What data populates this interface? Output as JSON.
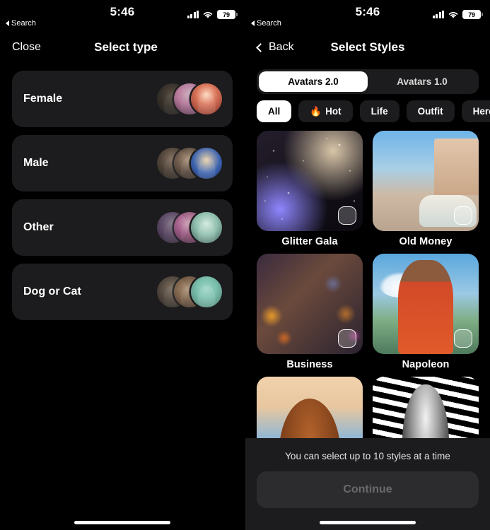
{
  "status_bar": {
    "time": "5:46",
    "back_label": "Search",
    "battery_percent": "79",
    "signal_icon": "cellular-bars-icon",
    "wifi_icon": "wifi-icon",
    "battery_icon": "battery-icon"
  },
  "left_screen": {
    "nav": {
      "close_label": "Close",
      "title": "Select type"
    },
    "types": [
      {
        "label": "Female",
        "avatars": [
          "a-dark",
          "a-pink",
          "a-red"
        ]
      },
      {
        "label": "Male",
        "avatars": [
          "a-man3",
          "a-man2",
          "a-pharaoh"
        ]
      },
      {
        "label": "Other",
        "avatars": [
          "a-purple",
          "a-punk",
          "a-mint"
        ]
      },
      {
        "label": "Dog or Cat",
        "avatars": [
          "a-dog3",
          "a-dog2",
          "a-shiba"
        ]
      }
    ]
  },
  "right_screen": {
    "nav": {
      "back_label": "Back",
      "title": "Select Styles",
      "back_icon": "chevron-left-icon"
    },
    "segments": [
      {
        "label": "Avatars 2.0",
        "selected": true
      },
      {
        "label": "Avatars 1.0",
        "selected": false
      }
    ],
    "filters": [
      {
        "label": "All",
        "icon": "",
        "selected": true
      },
      {
        "label": "Hot",
        "icon": "🔥",
        "selected": false
      },
      {
        "label": "Life",
        "icon": "",
        "selected": false
      },
      {
        "label": "Outfit",
        "icon": "",
        "selected": false
      },
      {
        "label": "Heroes",
        "icon": "",
        "selected": false
      }
    ],
    "styles": [
      {
        "label": "Glitter Gala",
        "art": "art-glitter",
        "checked": false
      },
      {
        "label": "Old Money",
        "art": "art-oldmoney",
        "checked": false
      },
      {
        "label": "Business",
        "art": "art-business",
        "checked": false
      },
      {
        "label": "Napoleon",
        "art": "art-napoleon",
        "checked": false
      },
      {
        "label": "",
        "art": "art-braids",
        "checked": false
      },
      {
        "label": "",
        "art": "art-zebra",
        "checked": false
      }
    ],
    "bottom": {
      "note": "You can select up to 10 styles at a time",
      "continue_label": "Continue",
      "continue_enabled": false
    }
  },
  "colors": {
    "background": "#000000",
    "card": "#1c1c1e",
    "card_alt": "#2c2c2e",
    "accent_selected": "#ffffff",
    "text_primary": "#ffffff",
    "text_disabled": "#6a6a6e"
  }
}
